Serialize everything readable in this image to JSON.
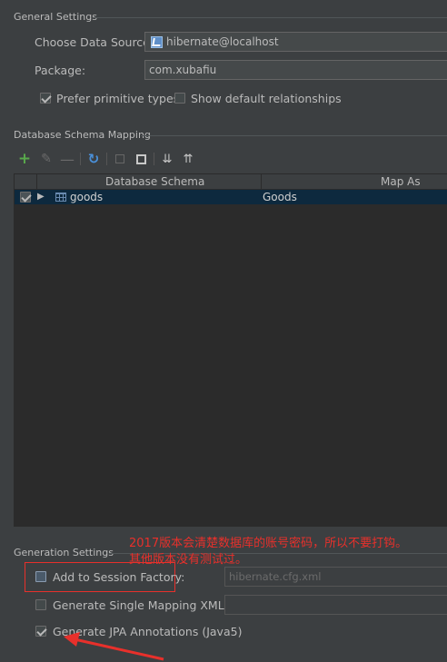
{
  "general": {
    "title": "General Settings",
    "data_source_label": "Choose Data Source:",
    "data_source_value": "hibernate@localhost",
    "package_label": "Package:",
    "package_value": "com.xubafiu",
    "prefer_primitive_label": "Prefer primitive types",
    "prefer_primitive_checked": true,
    "show_default_rel_label": "Show default relationships",
    "show_default_rel_checked": false
  },
  "mapping": {
    "title": "Database Schema Mapping",
    "toolbar": [
      "add-icon",
      "edit-icon",
      "remove-icon",
      "refresh-icon",
      "copy-icon",
      "paste-icon",
      "expand-all-icon",
      "collapse-all-icon"
    ],
    "columns": [
      "Database Schema",
      "Map As"
    ],
    "rows": [
      {
        "checked": true,
        "schema": "goods",
        "map_as": "Goods"
      }
    ]
  },
  "generation": {
    "title": "Generation Settings",
    "session_factory_label": "Add to Session Factory:",
    "session_factory_checked": false,
    "session_factory_value": "hibernate.cfg.xml",
    "single_mapping_label": "Generate Single Mapping XML:",
    "single_mapping_checked": false,
    "single_mapping_value": "",
    "jpa_label": "Generate JPA Annotations (Java5)",
    "jpa_checked": true
  },
  "annotation": {
    "line1": "2017版本会清楚数据库的账号密码，所以不要打钩。",
    "line2": "其他版本没有测试过。",
    "color": "#e8302b"
  }
}
